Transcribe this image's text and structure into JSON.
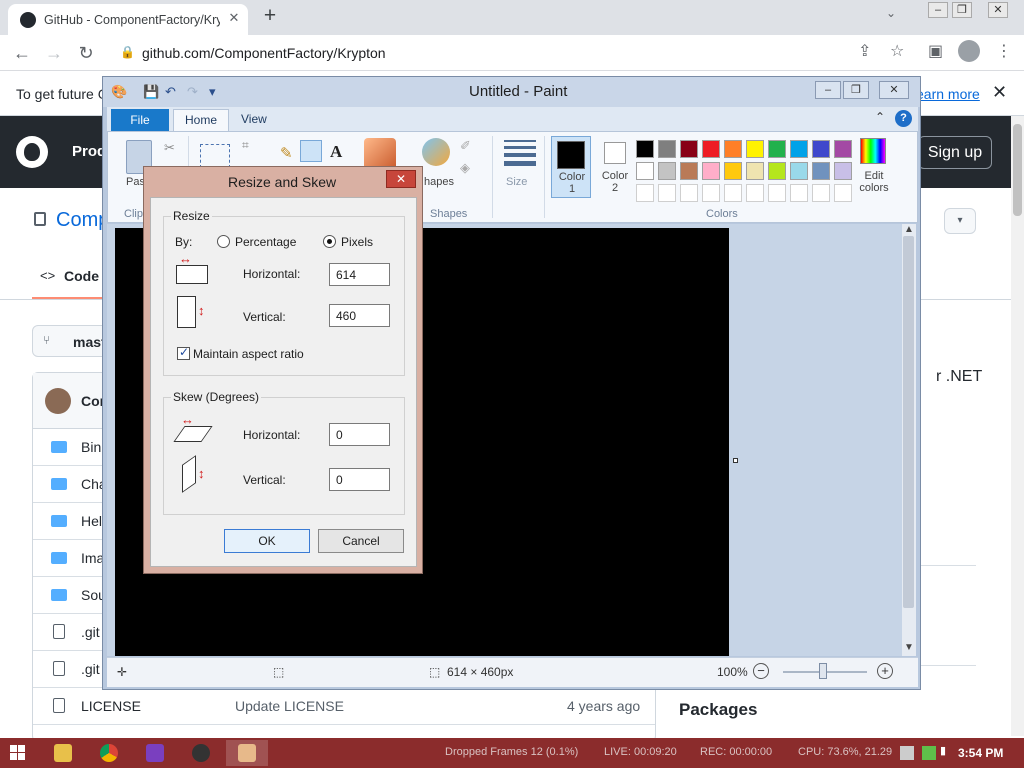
{
  "browser": {
    "tab_title": "GitHub - ComponentFactory/Krypton",
    "url": "github.com/ComponentFactory/Krypton",
    "new_tab": "+",
    "close": "✕"
  },
  "banner": {
    "text": "To get future G",
    "link": "earn more"
  },
  "github": {
    "nav": "Prod",
    "signup": "Sign up",
    "repo_name": "Comp",
    "code_tab": "Code",
    "branch": "mast",
    "commit_user": "Cor",
    "side_text": "r .NET",
    "packages": "Packages",
    "files": [
      {
        "name": "Bin",
        "type": "folder",
        "message": "",
        "age": ""
      },
      {
        "name": "Cha",
        "type": "folder",
        "message": "",
        "age": ""
      },
      {
        "name": "Hel",
        "type": "folder",
        "message": "",
        "age": ""
      },
      {
        "name": "Ima",
        "type": "folder",
        "message": "",
        "age": ""
      },
      {
        "name": "Sou",
        "type": "folder",
        "message": "",
        "age": ""
      },
      {
        "name": ".git",
        "type": "file",
        "message": "",
        "age": ""
      },
      {
        "name": ".git",
        "type": "file",
        "message": "",
        "age": ""
      },
      {
        "name": "LICENSE",
        "type": "file",
        "message": "Update LICENSE",
        "age": "4 years ago"
      }
    ]
  },
  "paint": {
    "title": "Untitled - Paint",
    "tabs": {
      "file": "File",
      "home": "Home",
      "view": "View"
    },
    "ribbon": {
      "paste": "Past",
      "clipboard": "Clip",
      "shapes_label": "hapes",
      "shapes_group": "Shapes",
      "size": "Size",
      "color1": "Color 1",
      "color2": "Color 2",
      "colors_group": "Colors",
      "edit_colors": "Edit colors"
    },
    "palette_row1": [
      "#000000",
      "#7f7f7f",
      "#880015",
      "#ed1c24",
      "#ff7f27",
      "#fff200",
      "#22b14c",
      "#00a2e8",
      "#3f48cc",
      "#a349a4"
    ],
    "palette_row2": [
      "#ffffff",
      "#c3c3c3",
      "#b97a57",
      "#ffaec9",
      "#ffc90e",
      "#efe4b0",
      "#b5e61d",
      "#99d9ea",
      "#7092be",
      "#c8bfe7"
    ],
    "status": {
      "size": "614 × 460px",
      "zoom": "100%"
    }
  },
  "dialog": {
    "title": "Resize and Skew",
    "resize_group": "Resize",
    "by": "By:",
    "percentage": "Percentage",
    "pixels": "Pixels",
    "selected_unit": "pixels",
    "horizontal_label": "Horizontal:",
    "vertical_label": "Vertical:",
    "horizontal_value": "614",
    "vertical_value": "460",
    "maintain": "Maintain aspect ratio",
    "maintain_checked": true,
    "skew_group": "Skew (Degrees)",
    "skew_horizontal_value": "0",
    "skew_vertical_value": "0",
    "ok": "OK",
    "cancel": "Cancel"
  },
  "taskbar": {
    "dropped": "Dropped Frames 12 (0.1%)",
    "live": "LIVE: 00:09:20",
    "rec": "REC: 00:00:00",
    "cpu": "CPU: 73.6%, 21.29",
    "clock": "3:54 PM"
  }
}
